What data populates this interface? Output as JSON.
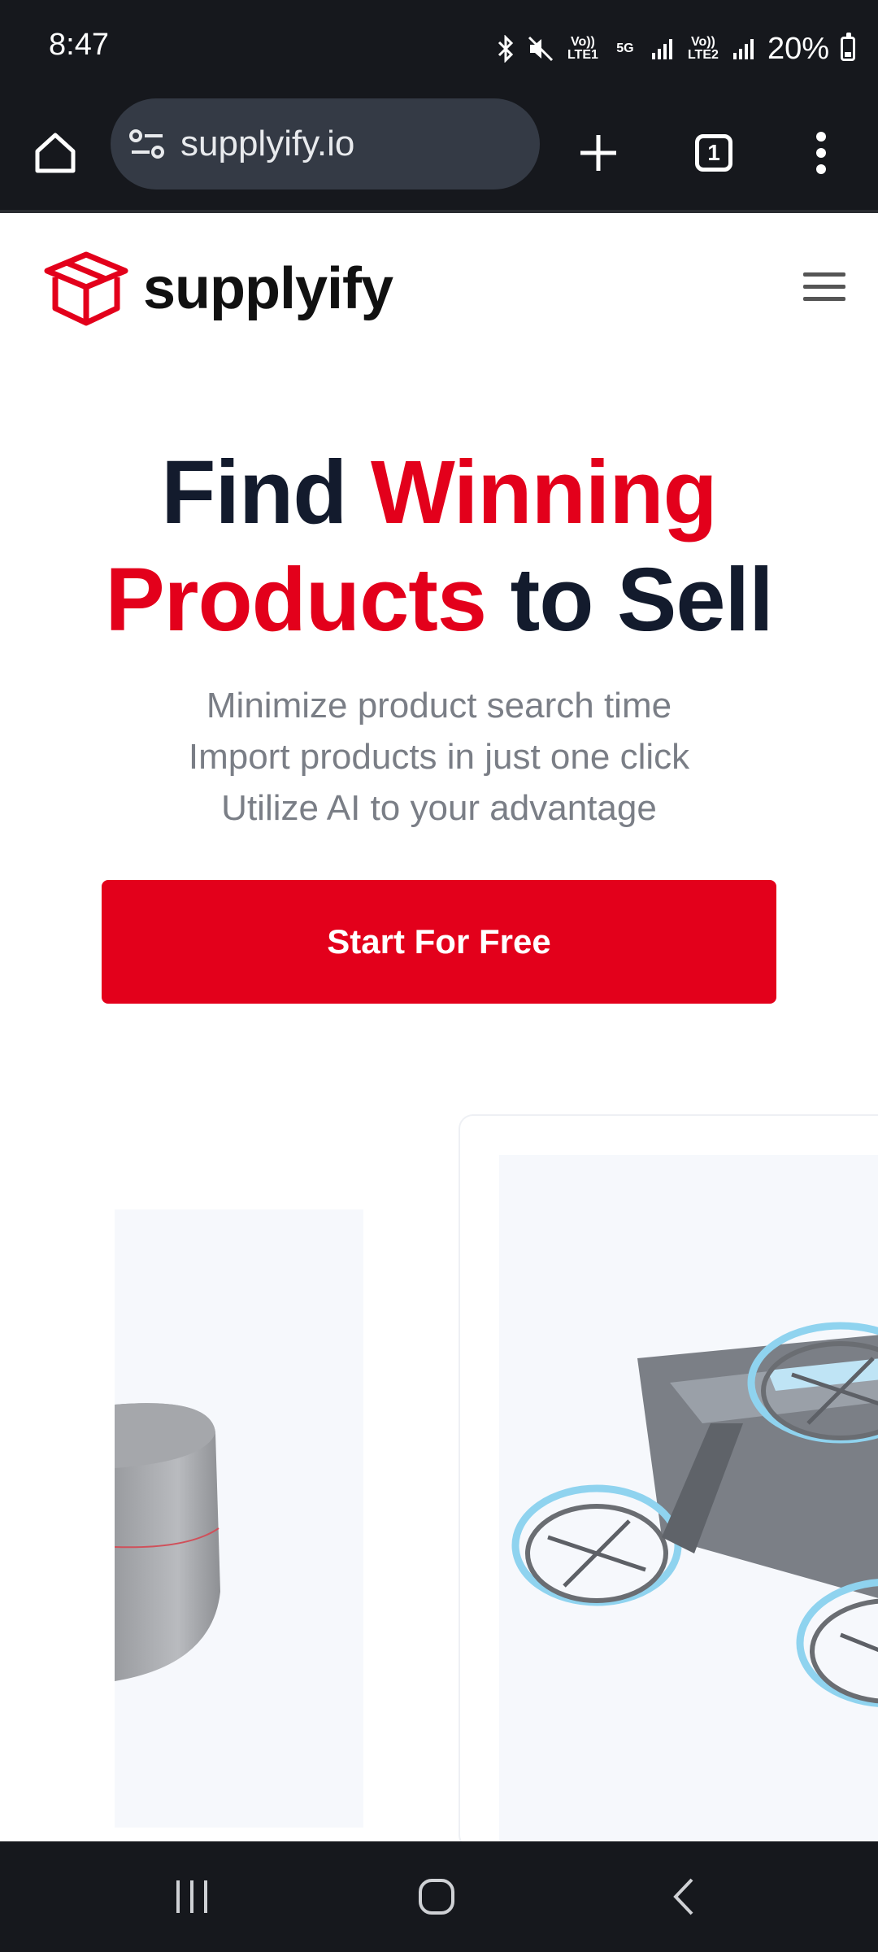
{
  "status_bar": {
    "time": "8:47",
    "network_labels": [
      "Vo)) LTE1",
      "5G",
      "Vo)) LTE2"
    ],
    "battery_percent": "20%"
  },
  "browser": {
    "url": "supplyify.io",
    "tab_count": "1"
  },
  "site": {
    "brand": "supplyify",
    "brand_color": "#e3001b"
  },
  "hero": {
    "headline_part1": "Find ",
    "headline_highlight1": "Winning",
    "headline_highlight2": "Products",
    "headline_part2": " to Sell",
    "subtext": [
      "Minimize product search time",
      "Import products in just one click",
      "Utilize AI to your advantage"
    ],
    "cta_label": "Start For Free"
  },
  "products": [
    {
      "icon": "smart-speaker-image"
    },
    {
      "icon": "drone-image"
    }
  ]
}
